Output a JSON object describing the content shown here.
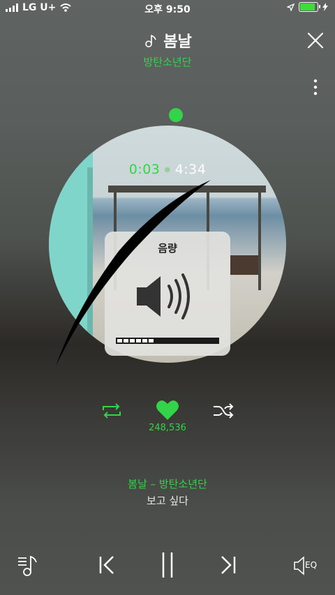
{
  "status_bar": {
    "carrier": "LG U+",
    "time": "오후 9:50",
    "battery_level": 0.85
  },
  "player": {
    "title": "봄날",
    "artist": "방탄소년단",
    "current_time": "0:03",
    "total_time": "4:34",
    "likes": "248,536",
    "progress": 0.01
  },
  "volume_popup": {
    "title": "음량",
    "level": 0.375
  },
  "lyrics": {
    "line1": "봄날 – 방탄소년단",
    "line2": "보고 싶다"
  },
  "bottom_bar": {
    "eq_label": "EQ"
  },
  "colors": {
    "accent": "#33d34a",
    "wall": "#7fd5c9"
  },
  "icons": [
    "signal-icon",
    "wifi-icon",
    "location-icon",
    "battery-icon",
    "charging-icon",
    "music-note-icon",
    "close-icon",
    "more-icon",
    "repeat-icon",
    "heart-icon",
    "shuffle-icon",
    "playlist-icon",
    "previous-icon",
    "pause-icon",
    "next-icon",
    "speaker-icon"
  ]
}
